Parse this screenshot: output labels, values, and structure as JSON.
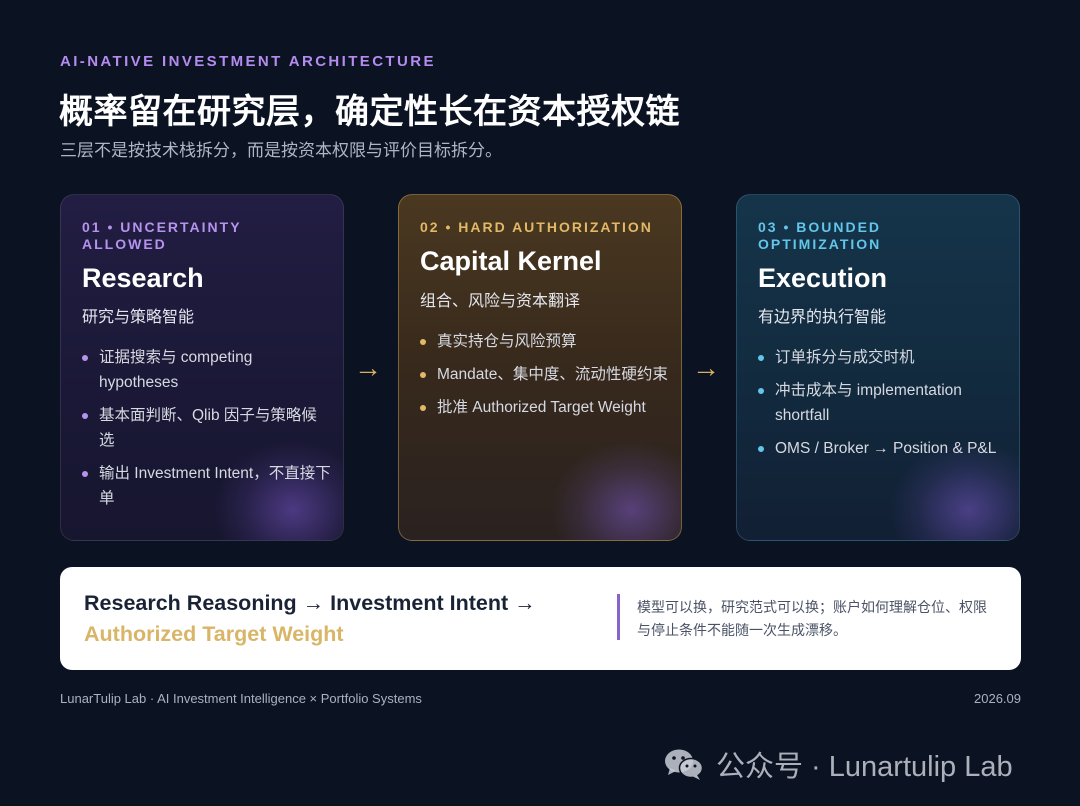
{
  "header": {
    "eyebrow": "AI-NATIVE INVESTMENT ARCHITECTURE",
    "title": "概率留在研究层，确定性长在资本授权链",
    "subtitle": "三层不是按技术栈拆分，而是按资本权限与评价目标拆分。"
  },
  "layers": [
    {
      "tag": "01 • UNCERTAINTY ALLOWED",
      "name": "Research",
      "desc": "研究与策略智能",
      "items": [
        "证据搜索与 competing hypotheses",
        "基本面判断、Qlib 因子与策略候选",
        "输出 Investment Intent，不直接下单"
      ]
    },
    {
      "tag": "02 • HARD AUTHORIZATION",
      "name": "Capital Kernel",
      "desc": "组合、风险与资本翻译",
      "items": [
        "真实持仓与风险预算",
        "Mandate、集中度、流动性硬约束",
        "批准 Authorized Target Weight"
      ]
    },
    {
      "tag": "03 • BOUNDED OPTIMIZATION",
      "name": "Execution",
      "desc": "有边界的执行智能",
      "items": [
        "订单拆分与成交时机",
        "冲击成本与 implementation shortfall",
        "OMS / Broker → Position & P&L"
      ]
    }
  ],
  "arrows": [
    "→",
    "→"
  ],
  "summary": {
    "formula_part1": "Research Reasoning → Investment Intent →",
    "formula_part2": "Authorized Target Weight",
    "note": "模型可以换，研究范式可以换；账户如何理解仓位、权限与停止条件不能随一次生成漂移。"
  },
  "footer": {
    "left": "LunarTulip Lab · AI Investment Intelligence × Portfolio Systems",
    "right": "2026.09"
  },
  "watermark": {
    "text": "公众号 · Lunartulip Lab",
    "icon": "wechat-icon"
  },
  "colors": {
    "background": "#0b1222",
    "research_accent": "#b593ee",
    "kernel_accent": "#e3b866",
    "execution_accent": "#62c5ea",
    "arrow": "#d9b060",
    "summary_bar": "#8a63c9"
  }
}
